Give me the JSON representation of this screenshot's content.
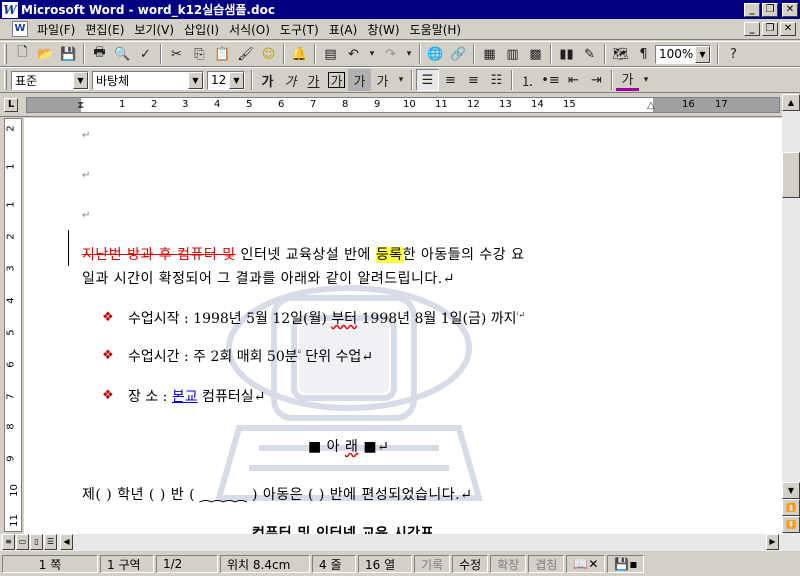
{
  "window": {
    "title": "Microsoft Word - word_k12실습샘플.doc",
    "app_icon": "W"
  },
  "menu": [
    "파일(F)",
    "편집(E)",
    "보기(V)",
    "삽입(I)",
    "서식(O)",
    "도구(T)",
    "표(A)",
    "창(W)",
    "도움말(H)"
  ],
  "standard_toolbar": {
    "zoom": "100%"
  },
  "formatting_toolbar": {
    "style": "표준",
    "font": "바탕체",
    "size": "12",
    "bold_label": "가",
    "italic_label": "가",
    "underline_label": "가",
    "box_label": "가",
    "shade_label": "가",
    "ruby_label": "가",
    "font_color_label": "가"
  },
  "ruler": {
    "numbers": [
      "1",
      "2",
      "3",
      "4",
      "5",
      "6",
      "7",
      "8",
      "9",
      "10",
      "11",
      "12",
      "13",
      "14",
      "15",
      "16",
      "17"
    ]
  },
  "vruler": {
    "numbers": [
      "2",
      "1",
      "1",
      "2",
      "3",
      "4",
      "5",
      "6",
      "7",
      "8",
      "9",
      "10",
      "11",
      "12"
    ]
  },
  "document": {
    "para_marks": [
      "↵",
      "↵",
      "↵"
    ],
    "strike_text": "지난번 방과 후 컴퓨터 및",
    "line1_rest_a": " 인터넷 교육상설 반에 ",
    "highlight_word": "등록",
    "line1_rest_b": "한 아동들의 수강 요",
    "line2": "일과 시간이 확정되어 그 결과를 아래와 같이 알려드립니다.↵",
    "bullets": [
      {
        "label": "수업시작",
        "sep": " : ",
        "value_a": "1998년 5월 12일(월) ",
        "value_wavy": "부터",
        "value_b": " 1998년 8월 1일(금) 까지",
        "note": "ⁱ↵"
      },
      {
        "label": "수업시간",
        "sep": " : ",
        "value_a": "주 2회 매회 50분",
        "note_mid": "ⁱⁱ",
        "value_b": " 단위 수업↵"
      },
      {
        "label": "장    소",
        "sep": " : ",
        "link": "본교",
        "value_b": " 컴퓨터실↵"
      }
    ],
    "bullet_glyph": "❖",
    "center_heading_a": "■ 아     ",
    "center_heading_wavy": "래",
    "center_heading_b": " ■↵",
    "form_line": "제(   ) 학년 (   ) 반 ( ⁔⁔⁔⁔ ) 아동은 (      ) 반에 편성되었습니다.↵",
    "cut_line": "컴퓨터 및 인터넷 교육 시간표"
  },
  "status": {
    "page": "1 쪽",
    "section": "1 구역",
    "pages": "1/2",
    "position": "위치 8.4cm",
    "line": "4 줄",
    "column": "16 열",
    "rec": "기록",
    "trk": "수정",
    "ext": "확장",
    "ovr": "겹침"
  }
}
